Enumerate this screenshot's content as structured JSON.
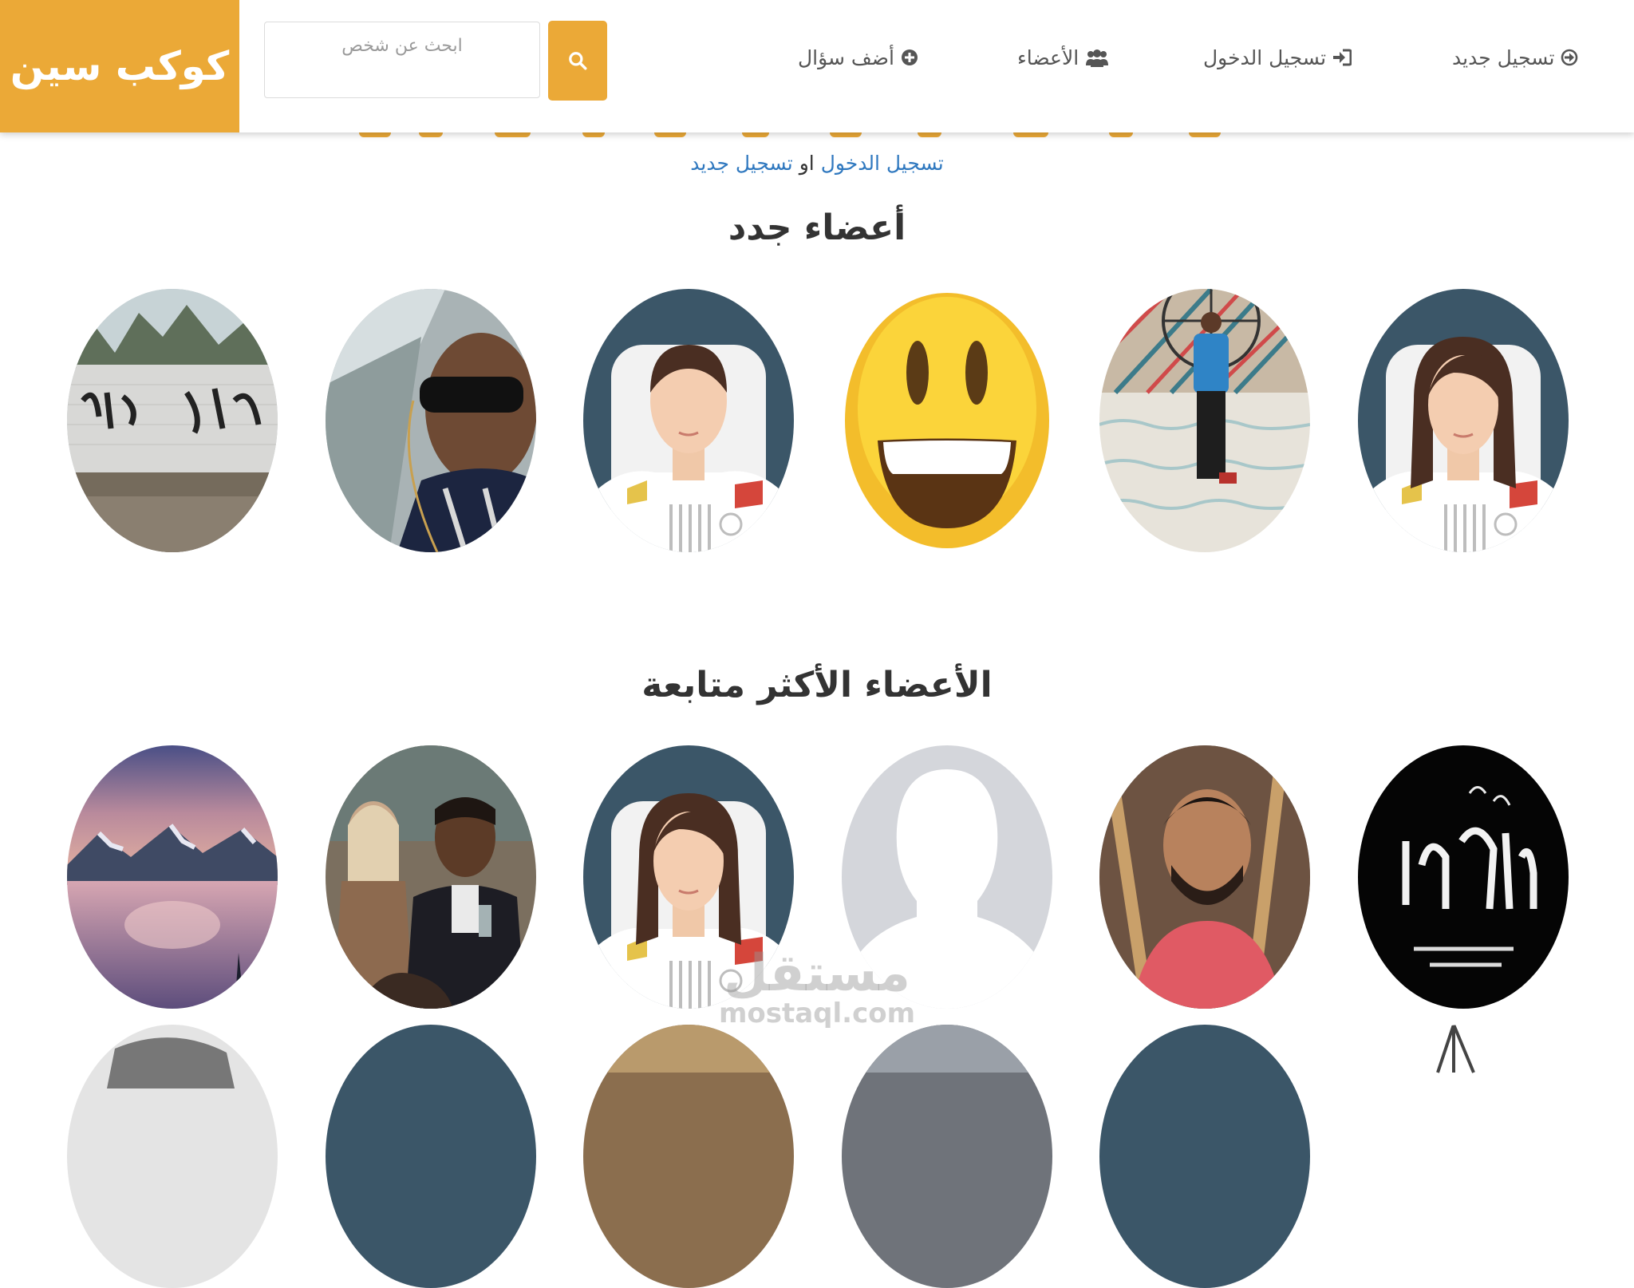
{
  "navbar": {
    "brand": "كوكب سين",
    "search": {
      "placeholder": "ابحث عن شخص"
    },
    "items": [
      {
        "label": "تسجيل جديد",
        "icon": "circle-arrow-icon"
      },
      {
        "label": "تسجيل الدخول",
        "icon": "sign-in-icon"
      },
      {
        "label": "الأعضاء",
        "icon": "users-icon"
      },
      {
        "label": "أضف سؤال",
        "icon": "plus-circle-icon"
      }
    ],
    "accent_color": "#eba937"
  },
  "auth_prompt": {
    "login_link": "تسجيل الدخول",
    "separator": "او",
    "register_link": "تسجيل جديد"
  },
  "sections": {
    "new_members_title": "أعضاء جدد",
    "most_followed_title": "الأعضاء الأكثر متابعة"
  },
  "watermark": {
    "arabic": "مستقل",
    "latin": "mostaql.com"
  }
}
